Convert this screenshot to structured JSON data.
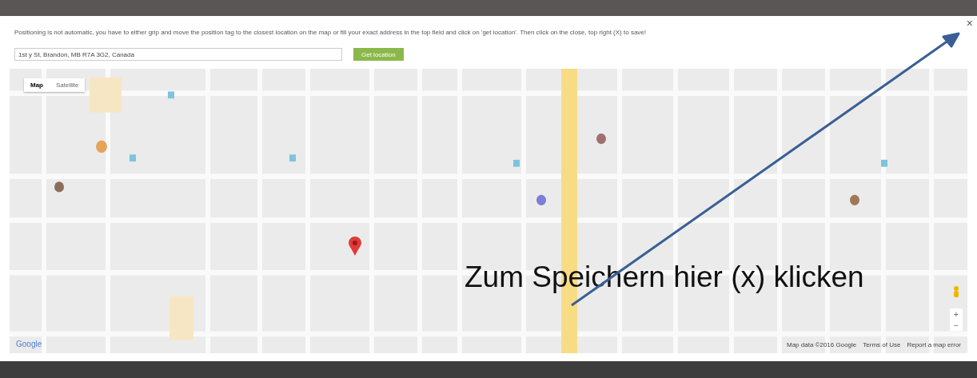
{
  "modal": {
    "instructions": "Positioning is not automatic, you have to either grip and move the position tag to the closest location on the map or fill your exact address in the top field and click on 'get location'. Then click on the close, top right (X) to save!",
    "address_field": {
      "value": "1st y St, Brandon, MB R7A 3G2, Canada"
    },
    "get_location_button": "Get location",
    "close_button": "×"
  },
  "map": {
    "type_tabs": [
      {
        "label": "Map",
        "selected": true
      },
      {
        "label": "Satellite",
        "selected": false
      }
    ],
    "logo": "Google",
    "footer_links": [
      "Map data ©2016 Google",
      "Terms of Use",
      "Report a map error"
    ],
    "zoom_in": "+",
    "zoom_out": "−"
  },
  "annotation": {
    "text": "Zum Speichern hier (x) klicken"
  }
}
